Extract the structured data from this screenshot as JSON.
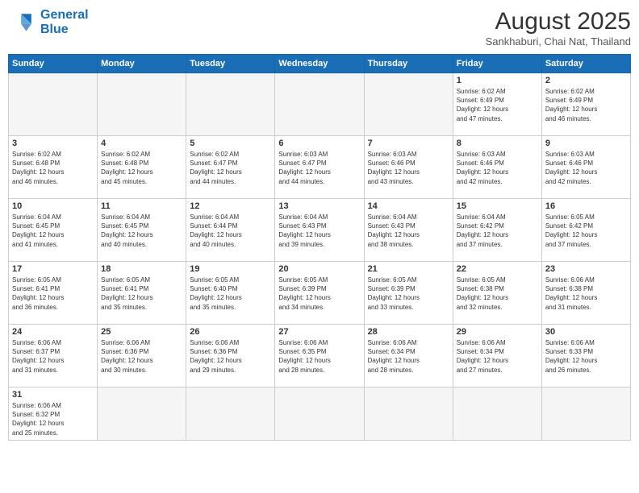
{
  "header": {
    "logo_line1": "General",
    "logo_line2": "Blue",
    "month_year": "August 2025",
    "location": "Sankhaburi, Chai Nat, Thailand"
  },
  "weekdays": [
    "Sunday",
    "Monday",
    "Tuesday",
    "Wednesday",
    "Thursday",
    "Friday",
    "Saturday"
  ],
  "weeks": [
    [
      {
        "day": "",
        "info": ""
      },
      {
        "day": "",
        "info": ""
      },
      {
        "day": "",
        "info": ""
      },
      {
        "day": "",
        "info": ""
      },
      {
        "day": "",
        "info": ""
      },
      {
        "day": "1",
        "info": "Sunrise: 6:02 AM\nSunset: 6:49 PM\nDaylight: 12 hours\nand 47 minutes."
      },
      {
        "day": "2",
        "info": "Sunrise: 6:02 AM\nSunset: 6:49 PM\nDaylight: 12 hours\nand 46 minutes."
      }
    ],
    [
      {
        "day": "3",
        "info": "Sunrise: 6:02 AM\nSunset: 6:48 PM\nDaylight: 12 hours\nand 46 minutes."
      },
      {
        "day": "4",
        "info": "Sunrise: 6:02 AM\nSunset: 6:48 PM\nDaylight: 12 hours\nand 45 minutes."
      },
      {
        "day": "5",
        "info": "Sunrise: 6:02 AM\nSunset: 6:47 PM\nDaylight: 12 hours\nand 44 minutes."
      },
      {
        "day": "6",
        "info": "Sunrise: 6:03 AM\nSunset: 6:47 PM\nDaylight: 12 hours\nand 44 minutes."
      },
      {
        "day": "7",
        "info": "Sunrise: 6:03 AM\nSunset: 6:46 PM\nDaylight: 12 hours\nand 43 minutes."
      },
      {
        "day": "8",
        "info": "Sunrise: 6:03 AM\nSunset: 6:46 PM\nDaylight: 12 hours\nand 42 minutes."
      },
      {
        "day": "9",
        "info": "Sunrise: 6:03 AM\nSunset: 6:46 PM\nDaylight: 12 hours\nand 42 minutes."
      }
    ],
    [
      {
        "day": "10",
        "info": "Sunrise: 6:04 AM\nSunset: 6:45 PM\nDaylight: 12 hours\nand 41 minutes."
      },
      {
        "day": "11",
        "info": "Sunrise: 6:04 AM\nSunset: 6:45 PM\nDaylight: 12 hours\nand 40 minutes."
      },
      {
        "day": "12",
        "info": "Sunrise: 6:04 AM\nSunset: 6:44 PM\nDaylight: 12 hours\nand 40 minutes."
      },
      {
        "day": "13",
        "info": "Sunrise: 6:04 AM\nSunset: 6:43 PM\nDaylight: 12 hours\nand 39 minutes."
      },
      {
        "day": "14",
        "info": "Sunrise: 6:04 AM\nSunset: 6:43 PM\nDaylight: 12 hours\nand 38 minutes."
      },
      {
        "day": "15",
        "info": "Sunrise: 6:04 AM\nSunset: 6:42 PM\nDaylight: 12 hours\nand 37 minutes."
      },
      {
        "day": "16",
        "info": "Sunrise: 6:05 AM\nSunset: 6:42 PM\nDaylight: 12 hours\nand 37 minutes."
      }
    ],
    [
      {
        "day": "17",
        "info": "Sunrise: 6:05 AM\nSunset: 6:41 PM\nDaylight: 12 hours\nand 36 minutes."
      },
      {
        "day": "18",
        "info": "Sunrise: 6:05 AM\nSunset: 6:41 PM\nDaylight: 12 hours\nand 35 minutes."
      },
      {
        "day": "19",
        "info": "Sunrise: 6:05 AM\nSunset: 6:40 PM\nDaylight: 12 hours\nand 35 minutes."
      },
      {
        "day": "20",
        "info": "Sunrise: 6:05 AM\nSunset: 6:39 PM\nDaylight: 12 hours\nand 34 minutes."
      },
      {
        "day": "21",
        "info": "Sunrise: 6:05 AM\nSunset: 6:39 PM\nDaylight: 12 hours\nand 33 minutes."
      },
      {
        "day": "22",
        "info": "Sunrise: 6:05 AM\nSunset: 6:38 PM\nDaylight: 12 hours\nand 32 minutes."
      },
      {
        "day": "23",
        "info": "Sunrise: 6:06 AM\nSunset: 6:38 PM\nDaylight: 12 hours\nand 31 minutes."
      }
    ],
    [
      {
        "day": "24",
        "info": "Sunrise: 6:06 AM\nSunset: 6:37 PM\nDaylight: 12 hours\nand 31 minutes."
      },
      {
        "day": "25",
        "info": "Sunrise: 6:06 AM\nSunset: 6:36 PM\nDaylight: 12 hours\nand 30 minutes."
      },
      {
        "day": "26",
        "info": "Sunrise: 6:06 AM\nSunset: 6:36 PM\nDaylight: 12 hours\nand 29 minutes."
      },
      {
        "day": "27",
        "info": "Sunrise: 6:06 AM\nSunset: 6:35 PM\nDaylight: 12 hours\nand 28 minutes."
      },
      {
        "day": "28",
        "info": "Sunrise: 6:06 AM\nSunset: 6:34 PM\nDaylight: 12 hours\nand 28 minutes."
      },
      {
        "day": "29",
        "info": "Sunrise: 6:06 AM\nSunset: 6:34 PM\nDaylight: 12 hours\nand 27 minutes."
      },
      {
        "day": "30",
        "info": "Sunrise: 6:06 AM\nSunset: 6:33 PM\nDaylight: 12 hours\nand 26 minutes."
      }
    ],
    [
      {
        "day": "31",
        "info": "Sunrise: 6:06 AM\nSunset: 6:32 PM\nDaylight: 12 hours\nand 25 minutes."
      },
      {
        "day": "",
        "info": ""
      },
      {
        "day": "",
        "info": ""
      },
      {
        "day": "",
        "info": ""
      },
      {
        "day": "",
        "info": ""
      },
      {
        "day": "",
        "info": ""
      },
      {
        "day": "",
        "info": ""
      }
    ]
  ]
}
